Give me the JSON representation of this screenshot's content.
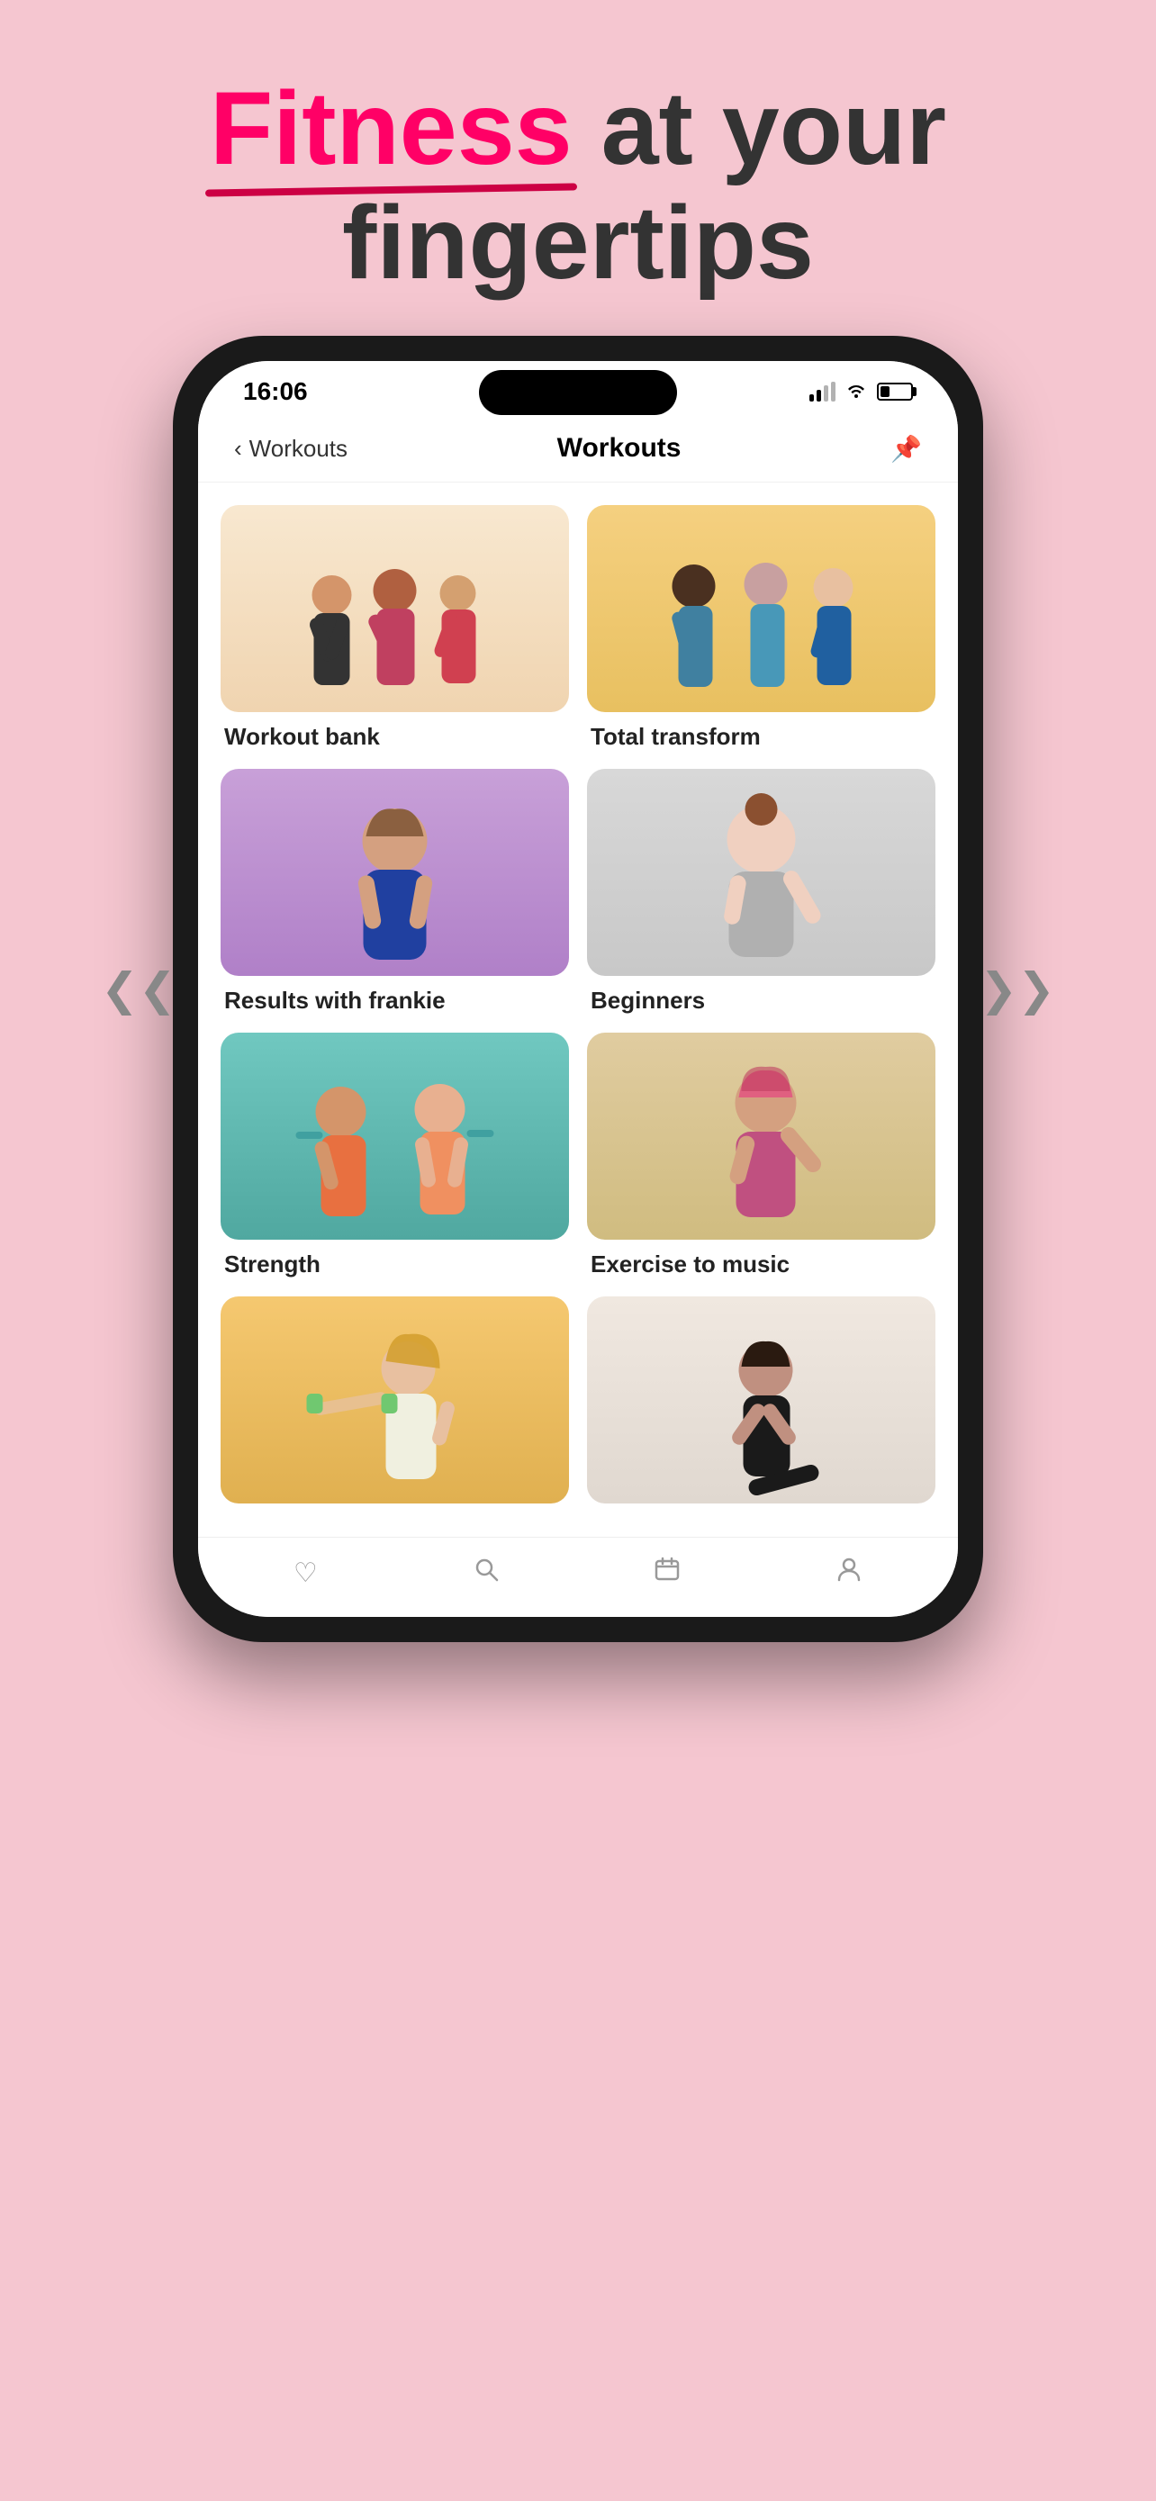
{
  "hero": {
    "line1_plain": " at your",
    "line1_accent": "Fitness",
    "line2": "fingertips"
  },
  "status_bar": {
    "time": "16:06",
    "signal": "signal",
    "wifi": "wifi",
    "battery": "battery"
  },
  "nav": {
    "back_label": "Workouts",
    "title": "Workouts",
    "pin_icon": "pin"
  },
  "workouts": [
    {
      "id": 1,
      "label": "Workout bank",
      "bg_class": "persons-workout-bank"
    },
    {
      "id": 2,
      "label": "Total transform",
      "bg_class": "persons-total-transform"
    },
    {
      "id": 3,
      "label": "Results with frankie",
      "bg_class": "persons-results"
    },
    {
      "id": 4,
      "label": "Beginners",
      "bg_class": "persons-beginners"
    },
    {
      "id": 5,
      "label": "Strength",
      "bg_class": "persons-strength"
    },
    {
      "id": 6,
      "label": "Exercise to music",
      "bg_class": "persons-exercise"
    },
    {
      "id": 7,
      "label": "",
      "bg_class": "persons-row4a"
    },
    {
      "id": 8,
      "label": "",
      "bg_class": "persons-row4b"
    }
  ],
  "bottom_nav": [
    {
      "id": "home",
      "icon": "♡",
      "label": ""
    },
    {
      "id": "search",
      "icon": "⊙",
      "label": ""
    },
    {
      "id": "calendar",
      "icon": "▭",
      "label": ""
    },
    {
      "id": "profile",
      "icon": "◯",
      "label": ""
    }
  ],
  "arrows": {
    "left": "❮❮",
    "right": "❯❯"
  }
}
